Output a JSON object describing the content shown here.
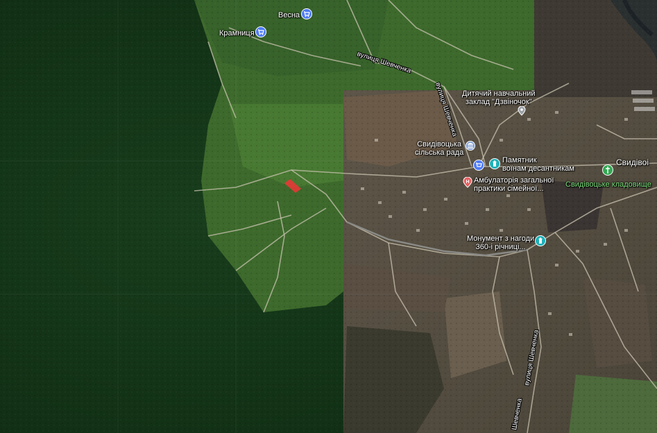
{
  "map": {
    "type": "satellite",
    "streets": {
      "shevchenka_top": "вулиця Шевченка",
      "shevchenka_vertical": "вулиця Шевченка",
      "shevchenka_lower": "вулиця Шевченка",
      "shevchenka_bottom": "Шевченка"
    },
    "pois": {
      "shop": {
        "name": "Крамниця",
        "icon": "shopping-cart-icon",
        "color": "#4f7cf5"
      },
      "vesna": {
        "name": "Весна",
        "icon": "shopping-cart-icon",
        "color": "#4f7cf5"
      },
      "kindergarten": {
        "line1": "Дитячий навчальний",
        "line2": "заклад \"Дзвіночок\"",
        "icon": "place-icon",
        "color": "#9aa0a6"
      },
      "council": {
        "line1": "Свидівоцька",
        "line2": "сільська рада",
        "icon": "government-icon",
        "color": "#7b9bd1"
      },
      "monument_paratroopers": {
        "line1": "Памятник",
        "line2": "воїнам десантникам",
        "icon": "monument-icon",
        "color": "#1fb1b8"
      },
      "clinic": {
        "line1": "Амбулаторія загальної",
        "line2": "практики сімейної...",
        "icon": "hospital-icon",
        "color": "#e46161"
      },
      "cemetery": {
        "name": "Свидівоцьке кладовище",
        "icon": "cemetery-icon",
        "color": "#34a853"
      },
      "monument_360": {
        "line1": "Монумент з нагоди",
        "line2": "360-і річниці...",
        "icon": "monument-icon",
        "color": "#1fb1b8"
      },
      "svydivok_partial": {
        "name": "Свидівоі"
      }
    }
  }
}
